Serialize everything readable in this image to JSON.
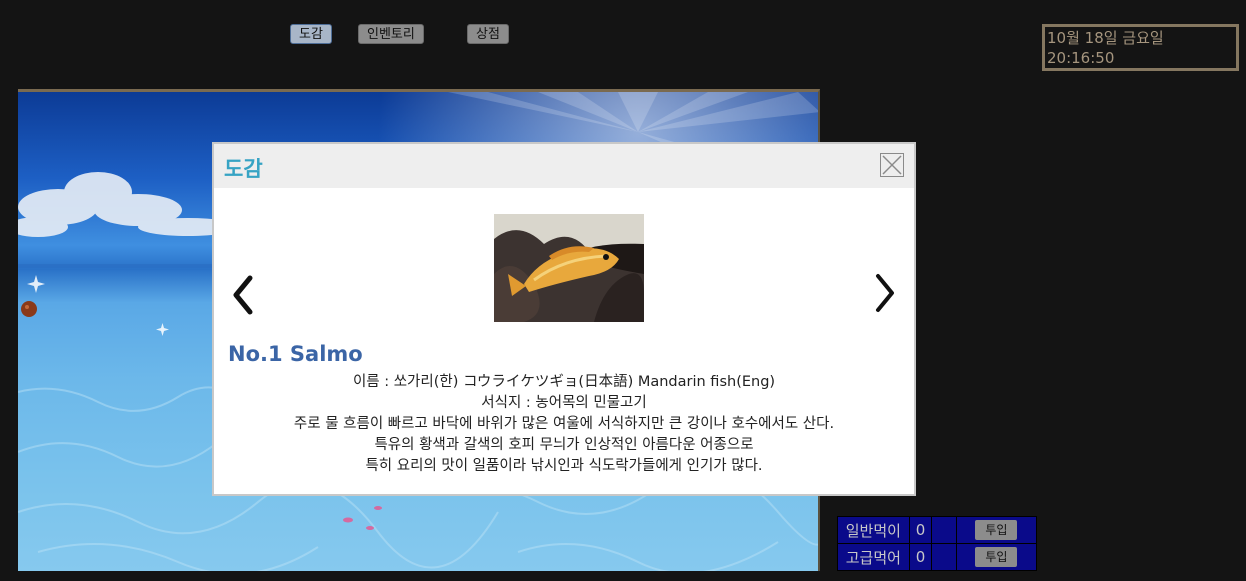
{
  "nav": {
    "encyclopedia_label": "도감",
    "inventory_label": "인벤토리",
    "shop_label": "상점"
  },
  "clock": {
    "date": "10월 18일 금요일",
    "time": "20:16:50"
  },
  "modal": {
    "title": "도감",
    "close_icon": "close-icon",
    "prev_icon": "chevron-left-icon",
    "next_icon": "chevron-right-icon",
    "fish": {
      "name": "No.1 Salmo",
      "desc_lines": [
        "이름 : 쏘가리(한) コウライケツギョ(日本語) Mandarin fish(Eng)",
        "서식지 : 농어목의 민물고기",
        "주로 물 흐름이 빠르고 바닥에 바위가 많은 여울에 서식하지만 큰 강이나 호수에서도 산다.",
        "특유의 황색과 갈색의 호피 무늬가 인상적인 아름다운 어종으로",
        "특히 요리의 맛이 일품이라 낚시인과 식도락가들에게 인기가 많다."
      ]
    }
  },
  "food": {
    "rows": [
      {
        "label": "일반먹이",
        "count": "0",
        "button": "투입"
      },
      {
        "label": "고급먹어",
        "count": "0",
        "button": "투입"
      }
    ]
  },
  "colors": {
    "background": "#141414",
    "modal_title": "#36a3c4",
    "fish_name": "#3b65a6",
    "clock_border": "#857760",
    "food_table_bg": "#0a0a8a"
  }
}
